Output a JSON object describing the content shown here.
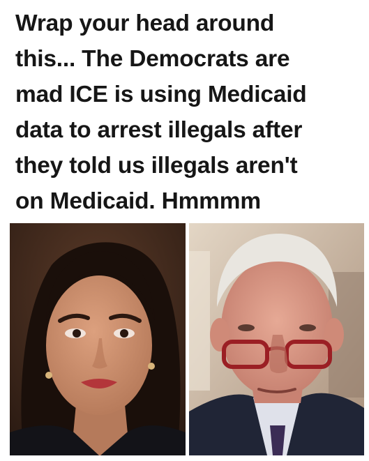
{
  "caption": {
    "lines": [
      "Wrap your head around",
      "this... The Democrats are",
      "mad ICE is using Medicaid",
      "data to arrest illegals after",
      "they told us illegals aren't",
      "on Medicaid. Hmmmm"
    ]
  },
  "photos": {
    "left": {
      "subject": "woman-portrait",
      "palette": {
        "background": "#2e1c14",
        "hair": "#1a0f0a",
        "skin": "#c98e6c",
        "lips": "#b3363a",
        "jacket": "#131318"
      }
    },
    "right": {
      "subject": "man-with-glasses-portrait",
      "palette": {
        "background": "#cdb8a2",
        "hair": "#e9e6e0",
        "skin": "#d89584",
        "glasses": "#9b1f24",
        "suit": "#202536",
        "shirt": "#dfe1ea",
        "tie": "#3b2c55"
      }
    }
  }
}
